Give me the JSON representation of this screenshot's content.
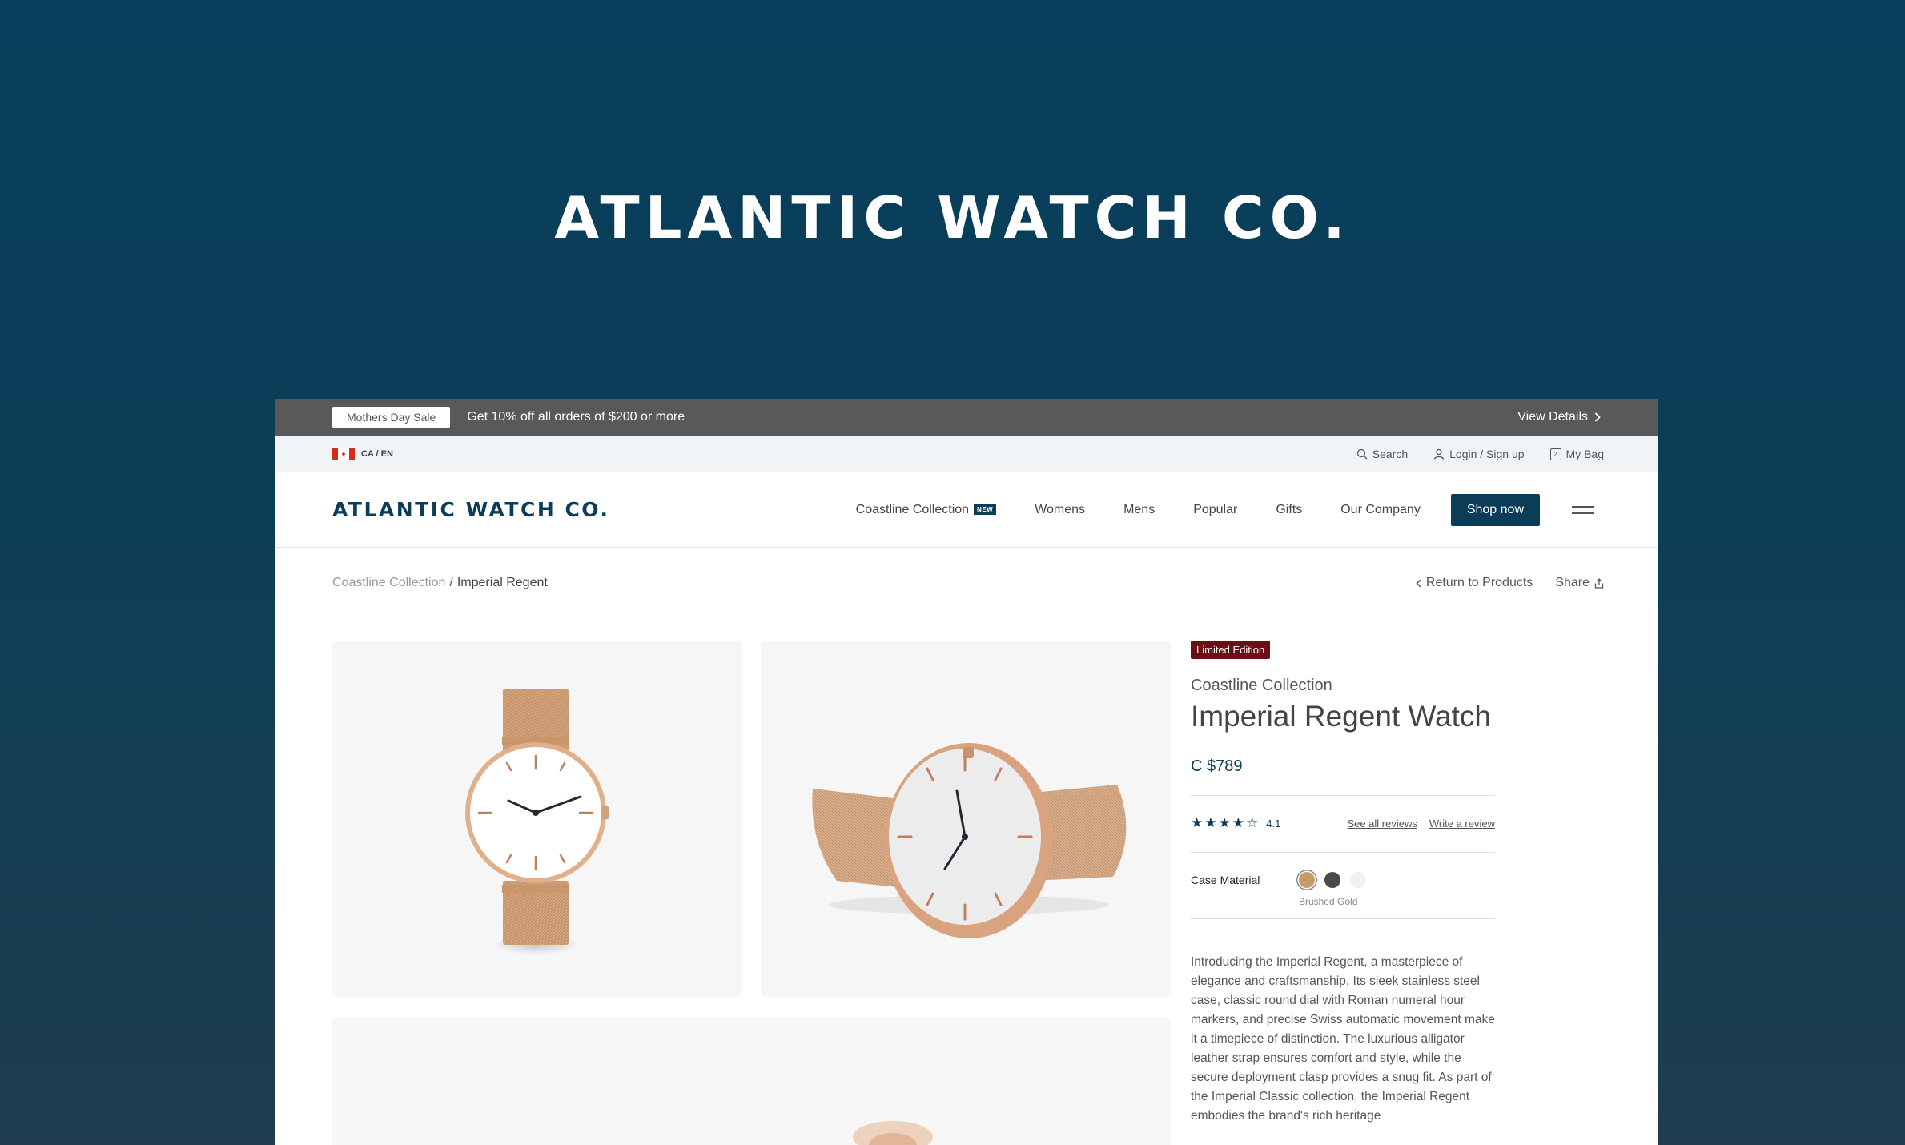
{
  "hero": {
    "title": "ATLANTIC WATCH CO."
  },
  "promo": {
    "badge": "Mothers Day Sale",
    "text": "Get 10% off all orders of $200 or more",
    "link": "View Details"
  },
  "utility": {
    "locale": "CA / EN",
    "search": "Search",
    "login": "Login / Sign up",
    "bag": "My Bag",
    "bag_count": "2"
  },
  "nav": {
    "logo": "ATLANTIC WATCH CO.",
    "items": [
      "Coastline Collection",
      "Womens",
      "Mens",
      "Popular",
      "Gifts",
      "Our Company"
    ],
    "new_badge": "NEW",
    "cta": "Shop now"
  },
  "breadcrumb": {
    "parent": "Coastline Collection",
    "separator": "/",
    "current": "Imperial Regent",
    "return": "Return to Products",
    "share": "Share"
  },
  "product": {
    "badge": "Limited Edition",
    "collection": "Coastline Collection",
    "title": "Imperial Regent Watch",
    "price": "C $789",
    "rating": "4.1",
    "rating_stars_filled": 4,
    "see_reviews": "See all reviews",
    "write_review": "Write a review",
    "material_label": "Case Material",
    "materials": [
      {
        "name": "Brushed Gold",
        "color": "#c79a6b"
      },
      {
        "name": "Graphite",
        "color": "#4a4a4a"
      },
      {
        "name": "Silver",
        "color": "#f2f2f2"
      }
    ],
    "selected_material": "Brushed Gold",
    "description": "Introducing the Imperial Regent, a masterpiece of elegance and craftsmanship. Its sleek stainless steel case, classic round dial with Roman numeral hour markers, and precise Swiss automatic movement make it a timepiece of distinction. The luxurious alligator leather strap ensures comfort and style, while the secure deployment clasp provides a snug fit. As part of the Imperial Classic collection, the Imperial Regent embodies the brand's rich heritage"
  },
  "colors": {
    "brand": "#0b3c58",
    "promo_bg": "#595959",
    "limited": "#6b0f14",
    "rose_gold": "#d6a680"
  }
}
